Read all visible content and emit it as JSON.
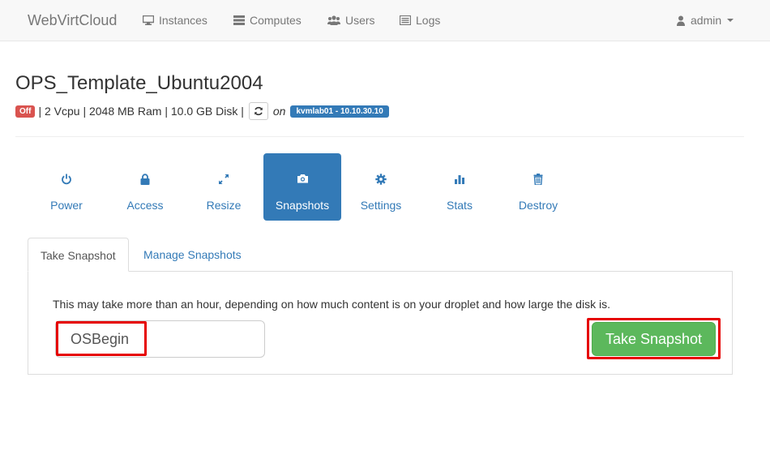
{
  "navbar": {
    "brand": "WebVirtCloud",
    "items": [
      {
        "label": "Instances",
        "icon": "monitor-icon"
      },
      {
        "label": "Computes",
        "icon": "server-icon"
      },
      {
        "label": "Users",
        "icon": "users-icon"
      },
      {
        "label": "Logs",
        "icon": "list-icon"
      }
    ],
    "user": {
      "label": "admin",
      "icon": "user-icon"
    }
  },
  "instance": {
    "name": "OPS_Template_Ubuntu2004",
    "status": "Off",
    "specs": "| 2 Vcpu | 2048 MB Ram | 10.0 GB Disk |",
    "on_label": "on",
    "host": "kvmlab01 - 10.10.30.10"
  },
  "actions": [
    {
      "label": "Power",
      "icon": "power-icon"
    },
    {
      "label": "Access",
      "icon": "lock-icon"
    },
    {
      "label": "Resize",
      "icon": "resize-icon"
    },
    {
      "label": "Snapshots",
      "icon": "camera-icon",
      "active": true
    },
    {
      "label": "Settings",
      "icon": "gear-icon"
    },
    {
      "label": "Stats",
      "icon": "bar-chart-icon"
    },
    {
      "label": "Destroy",
      "icon": "trash-icon"
    }
  ],
  "tabs": [
    {
      "label": "Take Snapshot",
      "active": true
    },
    {
      "label": "Manage Snapshots",
      "active": false
    }
  ],
  "snapshot": {
    "hint": "This may take more than an hour, depending on how much content is on your droplet and how large the disk is.",
    "name_value": "OSBegin",
    "button_label": "Take Snapshot"
  },
  "colors": {
    "primary": "#337ab7",
    "success": "#5cb85c",
    "danger": "#d9534f",
    "highlight": "#e60000"
  }
}
